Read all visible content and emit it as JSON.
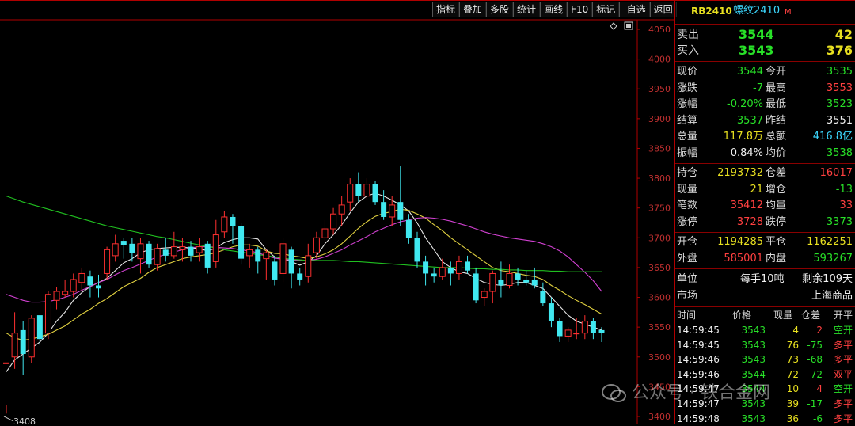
{
  "toolbar": [
    "指标",
    "叠加",
    "多股",
    "统计",
    "画线",
    "F10",
    "标记",
    "-自选",
    "返回"
  ],
  "price_axis": [
    "4050",
    "4000",
    "3950",
    "3900",
    "3850",
    "3800",
    "3750",
    "3700",
    "3650",
    "3600",
    "3550",
    "3500",
    "3450",
    "3400"
  ],
  "low_marker": "3408",
  "chart_data": {
    "type": "candlestick",
    "ylim": [
      3400,
      4050
    ],
    "candles": [
      [
        3490,
        3490,
        3420,
        3405
      ],
      [
        3500,
        3540,
        3575,
        3480
      ],
      [
        3545,
        3505,
        3560,
        3470
      ],
      [
        3500,
        3565,
        3570,
        3490
      ],
      [
        3570,
        3530,
        3570,
        3520
      ],
      [
        3540,
        3605,
        3610,
        3530
      ],
      [
        3595,
        3610,
        3618,
        3580
      ],
      [
        3605,
        3610,
        3630,
        3600
      ],
      [
        3610,
        3630,
        3640,
        3600
      ],
      [
        3625,
        3640,
        3650,
        3610
      ],
      [
        3635,
        3620,
        3645,
        3600
      ],
      [
        3620,
        3615,
        3638,
        3600
      ],
      [
        3640,
        3680,
        3685,
        3630
      ],
      [
        3670,
        3690,
        3705,
        3660
      ],
      [
        3695,
        3688,
        3700,
        3665
      ],
      [
        3690,
        3675,
        3700,
        3660
      ],
      [
        3665,
        3690,
        3700,
        3640
      ],
      [
        3690,
        3655,
        3695,
        3650
      ],
      [
        3655,
        3682,
        3690,
        3645
      ],
      [
        3680,
        3670,
        3700,
        3660
      ],
      [
        3670,
        3685,
        3710,
        3665
      ],
      [
        3680,
        3685,
        3700,
        3660
      ],
      [
        3685,
        3670,
        3695,
        3660
      ],
      [
        3675,
        3685,
        3700,
        3660
      ],
      [
        3690,
        3650,
        3695,
        3640
      ],
      [
        3660,
        3705,
        3730,
        3650
      ],
      [
        3710,
        3735,
        3745,
        3700
      ],
      [
        3735,
        3720,
        3740,
        3690
      ],
      [
        3720,
        3665,
        3725,
        3655
      ],
      [
        3670,
        3680,
        3690,
        3650
      ],
      [
        3680,
        3660,
        3685,
        3640
      ],
      [
        3665,
        3675,
        3680,
        3630
      ],
      [
        3660,
        3630,
        3670,
        3620
      ],
      [
        3640,
        3690,
        3700,
        3625
      ],
      [
        3680,
        3640,
        3685,
        3615
      ],
      [
        3640,
        3630,
        3650,
        3620
      ],
      [
        3635,
        3670,
        3690,
        3625
      ],
      [
        3675,
        3700,
        3710,
        3665
      ],
      [
        3700,
        3715,
        3730,
        3690
      ],
      [
        3715,
        3740,
        3750,
        3705
      ],
      [
        3740,
        3755,
        3770,
        3720
      ],
      [
        3760,
        3790,
        3800,
        3745
      ],
      [
        3790,
        3770,
        3810,
        3760
      ],
      [
        3770,
        3790,
        3800,
        3765
      ],
      [
        3790,
        3760,
        3795,
        3755
      ],
      [
        3760,
        3735,
        3780,
        3730
      ],
      [
        3735,
        3755,
        3770,
        3720
      ],
      [
        3760,
        3730,
        3820,
        3720
      ],
      [
        3730,
        3700,
        3740,
        3690
      ],
      [
        3700,
        3660,
        3710,
        3650
      ],
      [
        3660,
        3640,
        3670,
        3620
      ],
      [
        3640,
        3635,
        3650,
        3625
      ],
      [
        3635,
        3650,
        3665,
        3630
      ],
      [
        3650,
        3640,
        3660,
        3620
      ],
      [
        3640,
        3660,
        3670,
        3630
      ],
      [
        3660,
        3645,
        3670,
        3640
      ],
      [
        3640,
        3595,
        3650,
        3590
      ],
      [
        3600,
        3610,
        3615,
        3585
      ],
      [
        3610,
        3640,
        3645,
        3590
      ],
      [
        3630,
        3620,
        3660,
        3600
      ],
      [
        3620,
        3640,
        3655,
        3615
      ],
      [
        3640,
        3630,
        3650,
        3620
      ],
      [
        3630,
        3625,
        3645,
        3620
      ],
      [
        3630,
        3620,
        3650,
        3615
      ],
      [
        3610,
        3590,
        3625,
        3585
      ],
      [
        3590,
        3560,
        3600,
        3550
      ],
      [
        3560,
        3535,
        3565,
        3525
      ],
      [
        3535,
        3545,
        3550,
        3525
      ],
      [
        3540,
        3540,
        3565,
        3530
      ],
      [
        3540,
        3560,
        3570,
        3530
      ],
      [
        3560,
        3540,
        3565,
        3530
      ],
      [
        3545,
        3540,
        3550,
        3525
      ]
    ],
    "ma": [
      {
        "color": "#e6e6e6",
        "values": [
          3475,
          3495,
          3505,
          3515,
          3525,
          3540,
          3560,
          3575,
          3595,
          3608,
          3618,
          3625,
          3632,
          3645,
          3658,
          3665,
          3675,
          3680,
          3682,
          3683,
          3684,
          3684,
          3683,
          3682,
          3678,
          3683,
          3692,
          3697,
          3700,
          3700,
          3698,
          3680,
          3668,
          3665,
          3660,
          3654,
          3660,
          3670,
          3690,
          3705,
          3722,
          3742,
          3760,
          3770,
          3775,
          3770,
          3763,
          3755,
          3745,
          3725,
          3700,
          3680,
          3660,
          3650,
          3643,
          3640,
          3632,
          3625,
          3622,
          3620,
          3622,
          3625,
          3625,
          3620,
          3615,
          3600,
          3585,
          3570,
          3560,
          3555,
          3550,
          3545
        ]
      },
      {
        "color": "#e0d040",
        "values": [
          3540,
          3532,
          3528,
          3530,
          3534,
          3538,
          3545,
          3552,
          3562,
          3572,
          3580,
          3590,
          3598,
          3608,
          3618,
          3625,
          3632,
          3642,
          3650,
          3655,
          3660,
          3665,
          3668,
          3670,
          3672,
          3675,
          3680,
          3685,
          3688,
          3688,
          3686,
          3678,
          3674,
          3673,
          3670,
          3668,
          3665,
          3668,
          3673,
          3680,
          3690,
          3703,
          3716,
          3727,
          3736,
          3741,
          3744,
          3748,
          3746,
          3740,
          3733,
          3722,
          3712,
          3700,
          3690,
          3680,
          3670,
          3660,
          3650,
          3645,
          3643,
          3640,
          3637,
          3635,
          3630,
          3620,
          3612,
          3603,
          3595,
          3588,
          3580,
          3572
        ]
      },
      {
        "color": "#d040d0",
        "values": [
          3605,
          3600,
          3595,
          3592,
          3592,
          3593,
          3596,
          3600,
          3605,
          3612,
          3618,
          3625,
          3630,
          3638,
          3645,
          3650,
          3656,
          3662,
          3668,
          3672,
          3676,
          3680,
          3683,
          3685,
          3685,
          3684,
          3683,
          3682,
          3680,
          3678,
          3675,
          3670,
          3666,
          3664,
          3663,
          3662,
          3662,
          3664,
          3668,
          3674,
          3680,
          3688,
          3695,
          3702,
          3710,
          3716,
          3722,
          3727,
          3730,
          3733,
          3734,
          3733,
          3731,
          3728,
          3724,
          3720,
          3715,
          3710,
          3706,
          3703,
          3700,
          3698,
          3696,
          3694,
          3690,
          3685,
          3678,
          3668,
          3655,
          3642,
          3628,
          3610
        ]
      },
      {
        "color": "#20c020",
        "values": [
          3770,
          3765,
          3760,
          3756,
          3752,
          3748,
          3744,
          3740,
          3736,
          3732,
          3728,
          3724,
          3720,
          3717,
          3714,
          3711,
          3708,
          3705,
          3702,
          3700,
          3697,
          3694,
          3691,
          3688,
          3685,
          3683,
          3680,
          3678,
          3676,
          3674,
          3672,
          3670,
          3668,
          3666,
          3664,
          3663,
          3662,
          3662,
          3662,
          3662,
          3661,
          3660,
          3660,
          3659,
          3658,
          3657,
          3656,
          3655,
          3654,
          3653,
          3652,
          3651,
          3650,
          3650,
          3650,
          3649,
          3648,
          3648,
          3647,
          3647,
          3646,
          3646,
          3645,
          3645,
          3645,
          3644,
          3644,
          3643,
          3643,
          3643,
          3643,
          3643
        ]
      }
    ]
  },
  "panel": {
    "title_code": "RB2410",
    "title_name": "螺纹2410",
    "title_flag": "M",
    "sell_label": "卖出",
    "sell_price": "3544",
    "sell_vol": "42",
    "buy_label": "买入",
    "buy_price": "3543",
    "buy_vol": "376",
    "stats": [
      {
        "l1": "现价",
        "v1": "3544",
        "c1": "dn",
        "l2": "今开",
        "v2": "3535",
        "c2": "dn"
      },
      {
        "l1": "涨跌",
        "v1": "-7",
        "c1": "dn",
        "l2": "最高",
        "v2": "3553",
        "c2": "up"
      },
      {
        "l1": "涨幅",
        "v1": "-0.20%",
        "c1": "dn",
        "l2": "最低",
        "v2": "3523",
        "c2": "dn"
      },
      {
        "l1": "结算",
        "v1": "3537",
        "c1": "dn",
        "l2": "昨结",
        "v2": "3551",
        "c2": "wht"
      },
      {
        "l1": "总量",
        "v1": "117.8万",
        "c1": "yel",
        "l2": "总额",
        "v2": "416.8亿",
        "c2": "cyan"
      },
      {
        "l1": "振幅",
        "v1": "0.84%",
        "c1": "wht",
        "l2": "均价",
        "v2": "3538",
        "c2": "dn"
      }
    ],
    "stats2": [
      {
        "l1": "持仓",
        "v1": "2193732",
        "c1": "yel",
        "l2": "仓差",
        "v2": "16017",
        "c2": "up"
      },
      {
        "l1": "现量",
        "v1": "21",
        "c1": "yel",
        "l2": "增仓",
        "v2": "-13",
        "c2": "dn"
      },
      {
        "l1": "笔数",
        "v1": "35412",
        "c1": "up",
        "l2": "均量",
        "v2": "33",
        "c2": "up"
      },
      {
        "l1": "涨停",
        "v1": "3728",
        "c1": "up",
        "l2": "跌停",
        "v2": "3373",
        "c2": "dn"
      }
    ],
    "stats3": [
      {
        "l1": "开仓",
        "v1": "1194285",
        "c1": "yel",
        "l2": "平仓",
        "v2": "1162251",
        "c2": "yel"
      },
      {
        "l1": "外盘",
        "v1": "585001",
        "c1": "up",
        "l2": "内盘",
        "v2": "593267",
        "c2": "dn"
      }
    ],
    "unit_label": "单位",
    "unit_value": "每手10吨",
    "remain_value": "剩余109天",
    "market_label": "市场",
    "market_value": "上海商品",
    "tick_headers": [
      "时间",
      "价格",
      "现量",
      "仓差",
      "开平"
    ],
    "ticks": [
      {
        "t": "14:59:45",
        "p": "3543",
        "v": "4",
        "d": "2",
        "dc": "up",
        "k": "空开",
        "kc": "dn"
      },
      {
        "t": "14:59:45",
        "p": "3543",
        "v": "76",
        "d": "-75",
        "dc": "dn",
        "k": "多平",
        "kc": "up"
      },
      {
        "t": "14:59:46",
        "p": "3543",
        "v": "73",
        "d": "-68",
        "dc": "dn",
        "k": "多平",
        "kc": "up"
      },
      {
        "t": "14:59:46",
        "p": "3544",
        "v": "72",
        "d": "-72",
        "dc": "dn",
        "k": "双平",
        "kc": "up"
      },
      {
        "t": "14:59:47",
        "p": "3544",
        "v": "10",
        "d": "4",
        "dc": "up",
        "k": "空开",
        "kc": "dn"
      },
      {
        "t": "14:59:47",
        "p": "3543",
        "v": "39",
        "d": "-17",
        "dc": "dn",
        "k": "多平",
        "kc": "up"
      },
      {
        "t": "14:59:48",
        "p": "3543",
        "v": "36",
        "d": "-6",
        "dc": "dn",
        "k": "多平",
        "kc": "up"
      }
    ]
  },
  "watermark": "公众号 · 铁合金网"
}
